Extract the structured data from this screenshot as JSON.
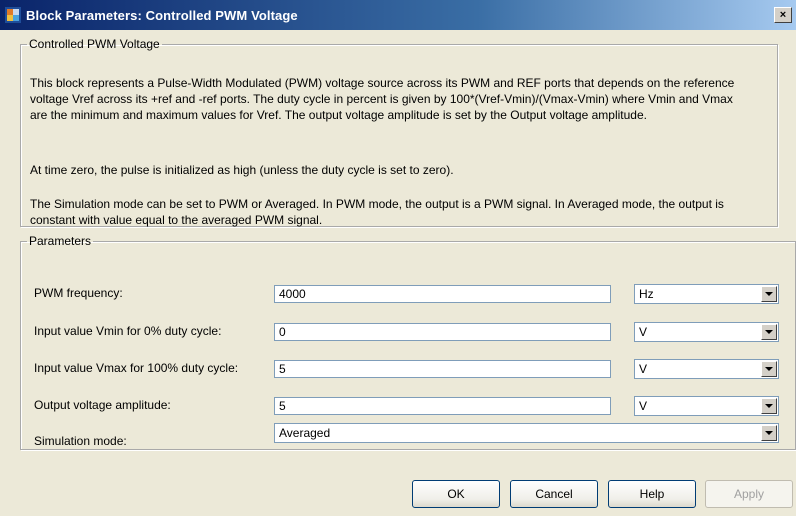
{
  "window": {
    "title": "Block Parameters: Controlled PWM Voltage",
    "close_glyph": "×"
  },
  "description": {
    "group_title": "Controlled PWM Voltage",
    "paragraph1": "This block represents a Pulse-Width Modulated (PWM) voltage source across its PWM and REF ports that depends on the reference voltage Vref across its +ref and -ref ports. The duty cycle in percent is given by 100*(Vref-Vmin)/(Vmax-Vmin) where Vmin and Vmax are the minimum and maximum values for Vref. The output voltage amplitude is set by the Output voltage amplitude.",
    "paragraph2": "At time zero, the pulse is initialized as high (unless the duty cycle is set to zero).",
    "paragraph3": "The Simulation mode can be set to PWM or Averaged. In PWM mode, the output is a PWM signal. In Averaged mode, the output is constant with value equal to the averaged PWM signal."
  },
  "parameters": {
    "group_title": "Parameters",
    "rows": [
      {
        "label": "PWM frequency:",
        "value": "4000",
        "unit": "Hz"
      },
      {
        "label": "Input value Vmin for 0% duty cycle:",
        "value": "0",
        "unit": "V"
      },
      {
        "label": "Input value Vmax for 100% duty cycle:",
        "value": "5",
        "unit": "V"
      },
      {
        "label": "Output voltage amplitude:",
        "value": "5",
        "unit": "V"
      }
    ],
    "simulation_mode": {
      "label": "Simulation mode:",
      "value": "Averaged"
    }
  },
  "buttons": {
    "ok": "OK",
    "cancel": "Cancel",
    "help": "Help",
    "apply": "Apply"
  },
  "colors": {
    "titlebar_start": "#0a246a",
    "titlebar_end": "#a6caf0",
    "dialog_background": "#ece9d8",
    "disabled_text": "#a0a0a0"
  }
}
